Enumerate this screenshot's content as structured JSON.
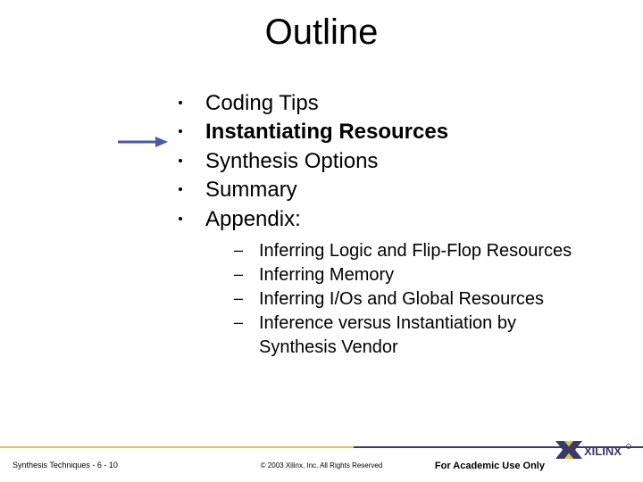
{
  "title": "Outline",
  "items": [
    {
      "text": "Coding Tips",
      "bold": false
    },
    {
      "text": "Instantiating Resources",
      "bold": true
    },
    {
      "text": "Synthesis Options",
      "bold": false
    },
    {
      "text": "Summary",
      "bold": false
    },
    {
      "text": "Appendix:",
      "bold": false
    }
  ],
  "subitems": [
    "Inferring Logic and Flip-Flop Resources",
    "Inferring Memory",
    "Inferring I/Os and Global Resources",
    "Inference versus Instantiation by Synthesis Vendor"
  ],
  "footer": {
    "left": "Synthesis Techniques  -  6  -  10",
    "center": "© 2003 Xilinx, Inc. All Rights Reserved",
    "right": "For Academic Use Only"
  }
}
